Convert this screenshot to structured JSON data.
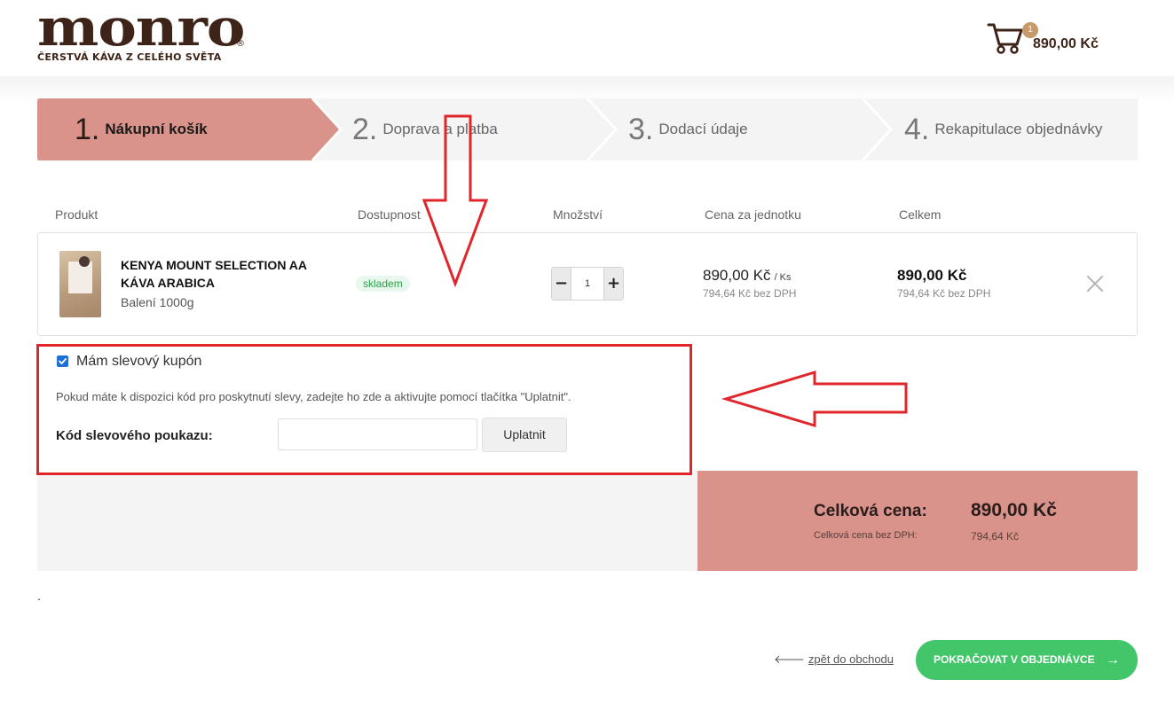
{
  "brand": {
    "logo_text": "monro",
    "registered_mark": "®",
    "tagline": "ČERSTVÁ KÁVA Z CELÉHO SVĚTA"
  },
  "header_cart": {
    "count": "1",
    "total": "890,00 Kč",
    "icon": "cart-icon"
  },
  "steps": [
    {
      "number": "1.",
      "label": "Nákupní košík",
      "active": true
    },
    {
      "number": "2.",
      "label": "Doprava a platba",
      "active": false
    },
    {
      "number": "3.",
      "label": "Dodací údaje",
      "active": false
    },
    {
      "number": "4.",
      "label": "Rekapitulace objednávky",
      "active": false
    }
  ],
  "table": {
    "columns": [
      "Produkt",
      "Dostupnost",
      "Množství",
      "Cena za jednotku",
      "Celkem"
    ],
    "rows": [
      {
        "name": "KENYA MOUNT SELECTION AA KÁVA ARABICA",
        "variant": "Balení 1000g",
        "availability": "skladem",
        "quantity": "1",
        "unit_price": "890,00 Kč",
        "unit": "/ Ks",
        "unit_price_net": "794,64 Kč bez DPH",
        "total": "890,00 Kč",
        "total_net": "794,64 Kč bez DPH"
      }
    ]
  },
  "quantity_controls": {
    "minus": "−",
    "plus": "+"
  },
  "coupon": {
    "checked": true,
    "label": "Mám slevový kupón",
    "help": "Pokud máte k dispozici kód pro poskytnutí slevy, zadejte ho zde a aktivujte pomocí tlačítka \"Uplatnit\".",
    "code_label": "Kód slevového poukazu:",
    "input_value": "",
    "apply_label": "Uplatnit"
  },
  "summary": {
    "total_label": "Celková cena:",
    "total_value": "890,00 Kč",
    "net_label": "Celková cena bez DPH:",
    "net_value": "794,64 Kč"
  },
  "misc": {
    "dot": "."
  },
  "footer": {
    "back_arrow": "🡐",
    "back_label": "zpět do obchodu",
    "continue_label": "POKRAČOVAT V OBJEDNÁVCE",
    "continue_arrow": "→"
  },
  "colors": {
    "brand_brown": "#3e2418",
    "step_active": "#d9938b",
    "summary_bg": "#d9938b",
    "continue_green": "#43c56a",
    "annotation_red": "#e0262b",
    "stock_green": "#2e9e4a"
  }
}
